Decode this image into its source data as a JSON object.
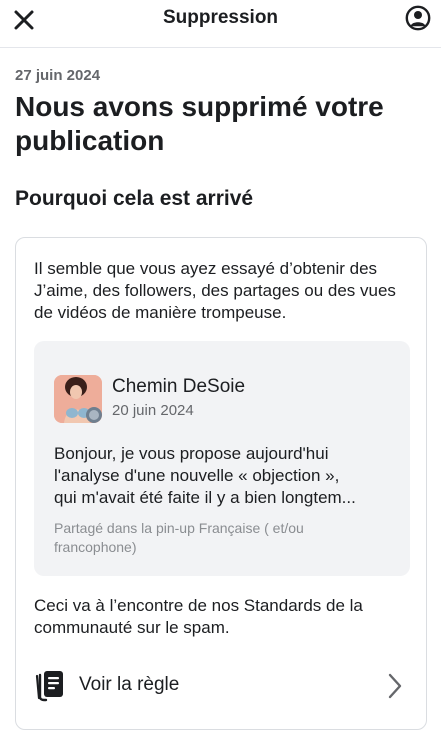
{
  "header": {
    "title": "Suppression",
    "close_icon": "close-icon",
    "account_icon": "account-icon"
  },
  "notice": {
    "date": "27 juin 2024",
    "title": "Nous avons supprimé votre publication",
    "section_title": "Pourquoi cela est arrivé",
    "reason": "Il semble que vous ayez essayé d’obtenir des J’aime, des followers, des partages ou des vues de vidéos de manière trompeuse.",
    "policy_text": "Ceci va à l’encontre de nos Standards de la communauté sur le spam."
  },
  "post": {
    "author": "Chemin DeSoie",
    "date": "20 juin 2024",
    "lines": [
      "Bonjour, je vous propose aujourd'hui",
      "l'analyse d'une nouvelle « objection »,",
      "qui m'avait été faite il y a bien longtem..."
    ],
    "source": "Partagé dans la pin-up Française ( et/ou francophone)"
  },
  "rule": {
    "label": "Voir la règle",
    "icon": "rulebook-icon",
    "chevron_icon": "chevron-right-icon"
  },
  "colors": {
    "text": "#1c1e21",
    "secondary": "#65676b",
    "muted": "#8a8d91",
    "post_bg": "#f2f3f5",
    "border": "#dadde1"
  }
}
